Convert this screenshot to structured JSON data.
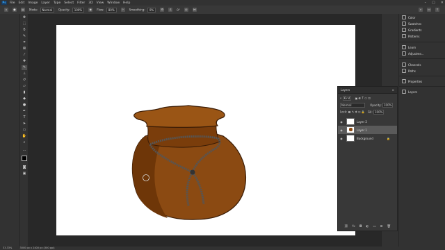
{
  "app": {
    "logo": "Ps"
  },
  "menu": [
    "File",
    "Edit",
    "Image",
    "Layer",
    "Type",
    "Select",
    "Filter",
    "3D",
    "View",
    "Window",
    "Help"
  ],
  "window_controls": {
    "minimize": "–",
    "maximize": "▢",
    "close": "✕"
  },
  "options_bar": {
    "mode_label": "Mode:",
    "mode_value": "Normal",
    "opacity_label": "Opacity:",
    "opacity_value": "100%",
    "flow_label": "Flow:",
    "flow_value": "80%",
    "smoothing_label": "Smoothing:",
    "smoothing_value": "0%",
    "angle_value": "0°"
  },
  "right_panels": [
    {
      "label": "Color"
    },
    {
      "label": "Swatches"
    },
    {
      "label": "Gradients"
    },
    {
      "label": "Patterns"
    },
    {
      "label": "Learn"
    },
    {
      "label": "Adjustme..."
    },
    {
      "label": "Channels"
    },
    {
      "label": "Paths"
    },
    {
      "label": "Properties"
    },
    {
      "label": "Layers"
    }
  ],
  "layers_panel": {
    "title": "Layers",
    "kind_label": "Kind",
    "blend_mode": "Normal",
    "opacity_label": "Opacity:",
    "opacity_value": "100%",
    "lock_label": "Lock:",
    "fill_label": "Fill:",
    "fill_value": "100%",
    "layers": [
      {
        "name": "Layer 2"
      },
      {
        "name": "Layer 1"
      },
      {
        "name": "Background"
      }
    ],
    "footer_icons": [
      "link-icon",
      "fx-icon",
      "mask-icon",
      "adjustment-icon",
      "folder-icon",
      "new-layer-icon",
      "trash-icon"
    ]
  },
  "status": {
    "zoom": "33.33%",
    "doc_info": "3000 px x 2400 px (300 ppi)"
  },
  "colors": {
    "bag_main": "#8b4a12",
    "bag_dark": "#6e3608",
    "bag_top": "#9a5515",
    "rope": "#555555"
  }
}
